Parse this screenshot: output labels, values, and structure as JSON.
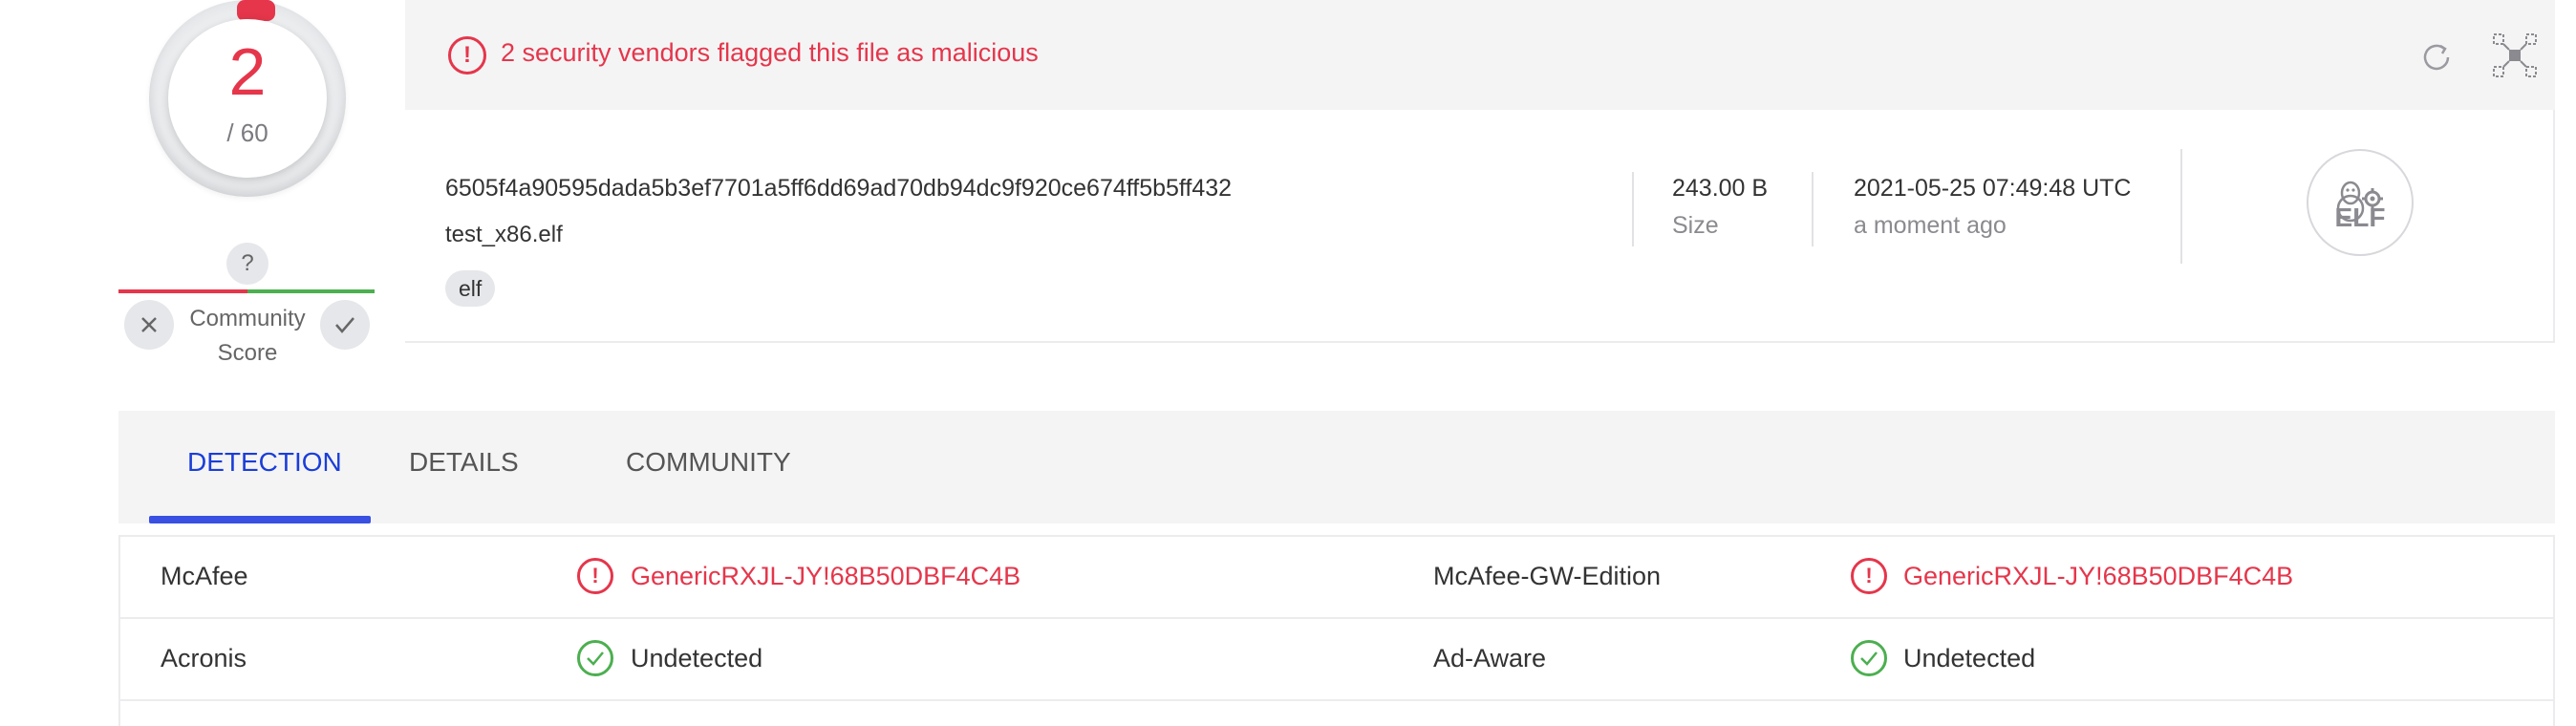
{
  "score": {
    "detections": "2",
    "total": "/ 60",
    "accent_color": "#e5364b"
  },
  "community": {
    "question_mark": "?",
    "label_line1": "Community",
    "label_line2": "Score",
    "downvote_icon": "close-icon",
    "upvote_icon": "check-icon"
  },
  "alert": {
    "icon": "!",
    "text": "2 security vendors flagged this file as malicious"
  },
  "file": {
    "hash": "6505f4a90595dada5b3ef7701a5ff6dd69ad70db94dc9f920ce674ff5b5ff432",
    "name": "test_x86.elf",
    "tag": "elf",
    "size_value": "243.00 B",
    "size_label": "Size",
    "date_value": "2021-05-25 07:49:48 UTC",
    "date_label": "a moment ago",
    "type_icon_text": "ELF"
  },
  "tabs": [
    {
      "label": "DETECTION",
      "active": true
    },
    {
      "label": "DETAILS",
      "active": false
    },
    {
      "label": "COMMUNITY",
      "active": false
    }
  ],
  "detections": [
    {
      "left_engine": "McAfee",
      "left_result": "GenericRXJL-JY!68B50DBF4C4B",
      "left_status": "malicious",
      "right_engine": "McAfee-GW-Edition",
      "right_result": "GenericRXJL-JY!68B50DBF4C4B",
      "right_status": "malicious"
    },
    {
      "left_engine": "Acronis",
      "left_result": "Undetected",
      "left_status": "undetected",
      "right_engine": "Ad-Aware",
      "right_result": "Undetected",
      "right_status": "undetected"
    }
  ],
  "colors": {
    "malicious": "#e5364b",
    "undetected": "#4caf50",
    "tab_active": "#1a3ed8"
  }
}
